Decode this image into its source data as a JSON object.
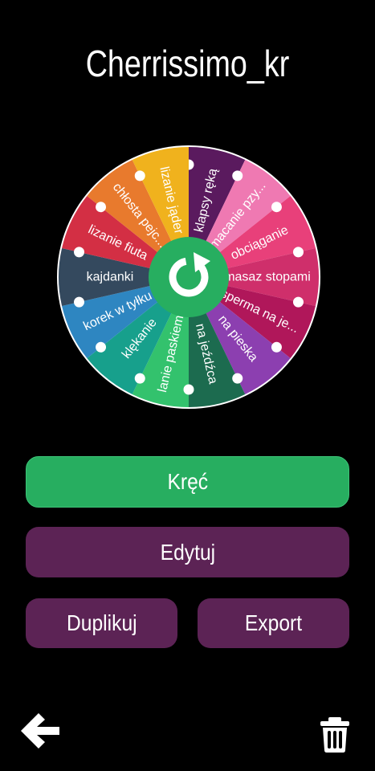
{
  "header": {
    "title": "Cherrissimo_kr"
  },
  "wheel": {
    "center_icon": "refresh-icon",
    "segments": [
      {
        "label": "klapsy ręką",
        "color": "#5a1a5e"
      },
      {
        "label": "macanie pzy...",
        "color": "#ef79b2"
      },
      {
        "label": "obciąganie",
        "color": "#e8407a"
      },
      {
        "label": "masaz stopami",
        "color": "#cf2f6b"
      },
      {
        "label": "sperma na je...",
        "color": "#b0175a"
      },
      {
        "label": "na pieska",
        "color": "#8c3fb0"
      },
      {
        "label": "na jeźdźca",
        "color": "#1c6b4f"
      },
      {
        "label": "lanie paskiem",
        "color": "#33c26d"
      },
      {
        "label": "klękanie",
        "color": "#17a08c"
      },
      {
        "label": "korek w tyłku",
        "color": "#2e86c1"
      },
      {
        "label": "kajdanki",
        "color": "#34495e"
      },
      {
        "label": "lizanie fiuta",
        "color": "#d32f44"
      },
      {
        "label": "chłosta pejc...",
        "color": "#e87a2d"
      },
      {
        "label": "lizanie jąder",
        "color": "#f0b21d"
      }
    ]
  },
  "buttons": {
    "spin": "Kręć",
    "edit": "Edytuj",
    "duplicate": "Duplikuj",
    "export": "Export"
  },
  "footer": {
    "back_icon": "back-arrow-icon",
    "delete_icon": "trash-icon"
  }
}
